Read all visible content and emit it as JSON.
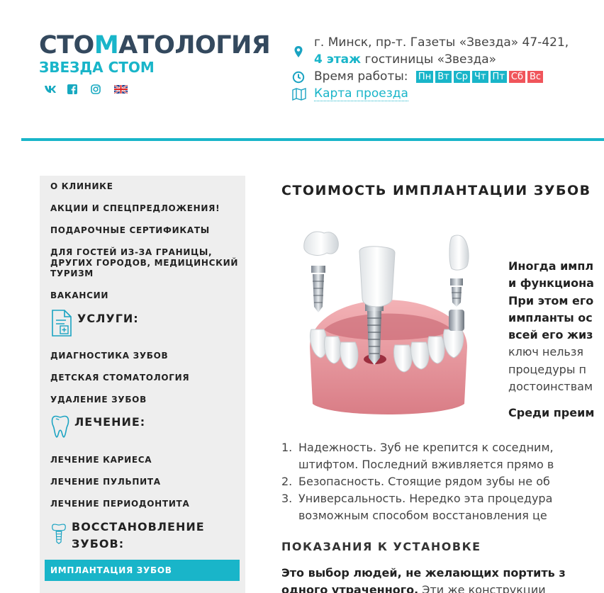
{
  "header": {
    "logo_main_left": "СТО",
    "logo_main_mid": "М",
    "logo_main_right": "АТОЛОГИЯ",
    "logo_sub": "ЗВЕЗДА СТОМ",
    "socials": [
      {
        "icon": "vk-icon",
        "glyph": "vk"
      },
      {
        "icon": "facebook-icon",
        "glyph": "f"
      },
      {
        "icon": "instagram-icon",
        "glyph": "◎"
      },
      {
        "icon": "uk-flag-icon",
        "glyph": ""
      }
    ],
    "address_line1": "г. Минск, пр-т. Газеты «Звезда» 47-421,",
    "address_floor": "4 этаж",
    "address_line2_rest": " гостиницы «Звезда»",
    "hours_label": "Время работы:",
    "days": [
      {
        "label": "Пн",
        "off": false
      },
      {
        "label": "Вт",
        "off": false
      },
      {
        "label": "Ср",
        "off": false
      },
      {
        "label": "Чт",
        "off": false
      },
      {
        "label": "Пт",
        "off": false
      },
      {
        "label": "Сб",
        "off": true
      },
      {
        "label": "Вс",
        "off": true
      }
    ],
    "map_link": "Карта проезда"
  },
  "sidebar": {
    "items": [
      {
        "label": "О КЛИНИКЕ"
      },
      {
        "label": "АКЦИИ И СПЕЦПРЕДЛОЖЕНИЯ!"
      },
      {
        "label": "ПОДАРОЧНЫЕ СЕРТИФИКАТЫ"
      },
      {
        "label": "ДЛЯ ГОСТЕЙ ИЗ-ЗА ГРАНИЦЫ,"
      },
      {
        "label": "ДРУГИХ ГОРОДОВ, МЕДИЦИНСКИЙ"
      },
      {
        "label": "ТУРИЗМ"
      },
      {
        "label": "ВАКАНСИИ"
      }
    ],
    "services_head": "УСЛУГИ:",
    "services": [
      {
        "label": "ДИАГНОСТИКА ЗУБОВ"
      },
      {
        "label": "ДЕТСКАЯ СТОМАТОЛОГИЯ"
      },
      {
        "label": "УДАЛЕНИЕ ЗУБОВ"
      }
    ],
    "treatment_head": "ЛЕЧЕНИЕ:",
    "treatment": [
      {
        "label": "ЛЕЧЕНИЕ КАРИЕСА"
      },
      {
        "label": "ЛЕЧЕНИЕ ПУЛЬПИТА"
      },
      {
        "label": "ЛЕЧЕНИЕ ПЕРИОДОНТИТА"
      }
    ],
    "restore_head_1": "ВОССТАНОВЛЕНИЕ",
    "restore_head_2": "ЗУБОВ:",
    "active_item": "ИМПЛАНТАЦИЯ ЗУБОВ"
  },
  "main": {
    "title": "СТОИМОСТЬ ИМПЛАНТАЦИИ ЗУБОВ",
    "intro_lines": [
      {
        "text": "Иногда импл",
        "bold": true
      },
      {
        "text": "и функциона",
        "bold": true
      },
      {
        "text": "При этом его",
        "bold": true
      },
      {
        "text": "импланты ос",
        "bold": true
      },
      {
        "text": "всей его жиз",
        "bold": true
      },
      {
        "text": "ключ нельзя",
        "bold": false
      },
      {
        "text": "процедуры п",
        "bold": false
      },
      {
        "text": "достоинствам",
        "bold": false
      }
    ],
    "benefits_head": "Среди преим",
    "benefits": [
      {
        "num": "1.",
        "lines": [
          "Надежность. Зуб не крепится к соседним,",
          "штифтом. Последний вживляется прямо в"
        ]
      },
      {
        "num": "2.",
        "lines": [
          "Безопасность. Стоящие рядом зубы не об"
        ]
      },
      {
        "num": "3.",
        "lines": [
          "Универсальность. Нередко эта процедура",
          "возможным способом восстановления це"
        ]
      }
    ],
    "indications_title": "ПОКАЗАНИЯ К УСТАНОВКЕ",
    "bottom_bold_1": "Это выбор людей, не желающих портить з",
    "bottom_bold_2": "одного утраченного.",
    "bottom_rest_2": " Эти же конструкции",
    "colors": {
      "accent": "#19b5c9",
      "off_day": "#f0555b",
      "logo_dark": "#34495e",
      "sidebar_bg": "#eeeeee"
    }
  }
}
